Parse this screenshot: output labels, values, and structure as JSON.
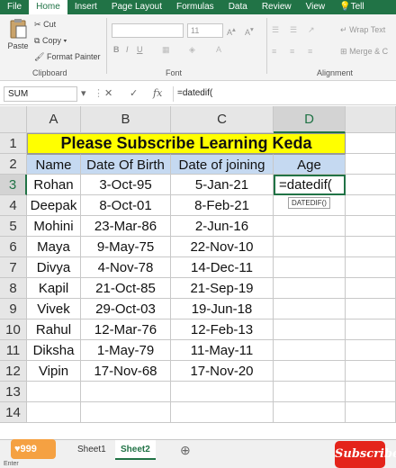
{
  "ribbon": {
    "tabs": [
      "File",
      "Home",
      "Insert",
      "Page Layout",
      "Formulas",
      "Data",
      "Review",
      "View",
      "Tell"
    ],
    "clipboard": {
      "paste_label": "Paste",
      "cut_label": "Cut",
      "copy_label": "Copy",
      "format_painter_label": "Format Painter",
      "group_label": "Clipboard"
    },
    "font": {
      "size_value": "11",
      "group_label": "Font"
    },
    "alignment": {
      "wrap_label": "Wrap Text",
      "merge_label": "Merge & C",
      "group_label": "Alignment"
    }
  },
  "formula_bar": {
    "name_box": "SUM",
    "cancel_icon": "✕",
    "enter_icon": "✓",
    "fx_label": "fx",
    "formula": "=datedif("
  },
  "grid": {
    "columns": [
      "A",
      "B",
      "C",
      "D"
    ],
    "rows": [
      "1",
      "2",
      "3",
      "4",
      "5",
      "6",
      "7",
      "8",
      "9",
      "10",
      "11",
      "12",
      "13",
      "14"
    ],
    "title": "Please Subscribe Learning Keda",
    "headers": [
      "Name",
      "Date Of Birth",
      "Date of joining",
      "Age"
    ],
    "data_rows": [
      {
        "name": "Rohan",
        "dob": "3-Oct-95",
        "doj": "5-Jan-21"
      },
      {
        "name": "Deepak",
        "dob": "8-Oct-01",
        "doj": "8-Feb-21"
      },
      {
        "name": "Mohini",
        "dob": "23-Mar-86",
        "doj": "2-Jun-16"
      },
      {
        "name": "Maya",
        "dob": "9-May-75",
        "doj": "22-Nov-10"
      },
      {
        "name": "Divya",
        "dob": "4-Nov-78",
        "doj": "14-Dec-11"
      },
      {
        "name": "Kapil",
        "dob": "21-Oct-85",
        "doj": "21-Sep-19"
      },
      {
        "name": "Vivek",
        "dob": "29-Oct-03",
        "doj": "19-Jun-18"
      },
      {
        "name": "Rahul",
        "dob": "12-Mar-76",
        "doj": "12-Feb-13"
      },
      {
        "name": "Diksha",
        "dob": "1-May-79",
        "doj": "11-May-11"
      },
      {
        "name": "Vipin",
        "dob": "17-Nov-68",
        "doj": "17-Nov-20"
      }
    ],
    "active_cell_text": "=datedif(",
    "tooltip": "DATEDIF()"
  },
  "sheets": {
    "tabs": [
      "Sheet1",
      "Sheet2"
    ],
    "add_icon": "⊕"
  },
  "status": {
    "mode": "Enter"
  },
  "overlay": {
    "likes_count": "999",
    "subscribe_label": "Subscribe"
  }
}
